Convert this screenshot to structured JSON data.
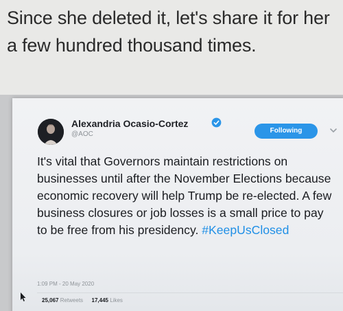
{
  "caption": "Since she deleted it, let's share it for her a few hundred thousand times.",
  "tweet": {
    "author_name": "Alexandria Ocasio-Cortez",
    "handle": "@AOC",
    "follow_label": "Following",
    "body": "It's vital that Governors maintain restrictions on businesses until after the November Elections because economic recovery will help Trump be re-elected. A few business closures or job losses is a small price to pay to be free from his presidency.",
    "hashtag": "#KeepUsClosed",
    "timestamp": "1:09 PM - 20 May 2020",
    "retweets_count": "25,067",
    "retweets_label": "Retweets",
    "likes_count": "17,445",
    "likes_label": "Likes"
  },
  "colors": {
    "accent": "#2b95e8",
    "hashtag": "#1f8fe6",
    "text": "#1a1c20"
  },
  "icons": {
    "verified": "verified-badge-icon",
    "chevron": "chevron-down-icon",
    "cursor": "mouse-cursor-icon"
  }
}
